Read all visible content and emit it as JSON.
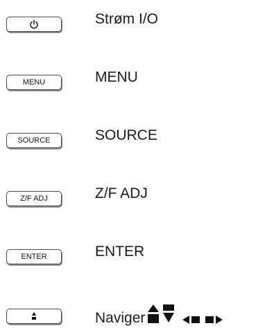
{
  "rows": [
    {
      "key_label": "",
      "key_icon": "power-icon",
      "description": "Strøm I/O"
    },
    {
      "key_label": "MENU",
      "description": "MENU"
    },
    {
      "key_label": "SOURCE",
      "description": "SOURCE"
    },
    {
      "key_label": "Z/F ADJ",
      "description": "Z/F ADJ"
    },
    {
      "key_label": "ENTER",
      "description": "ENTER"
    },
    {
      "key_label": "",
      "key_icon": "up-down-arrows-icon",
      "description": "Naviger",
      "nav_icons": [
        "up-arrow-icon",
        "down-arrow-icon",
        "left-arrow-icon",
        "right-arrow-icon"
      ]
    }
  ],
  "colors": {
    "text": "#1a1a1a",
    "key_border": "#4a4a4a",
    "key_shadow": "#8a8a8a",
    "background": "#ffffff"
  }
}
